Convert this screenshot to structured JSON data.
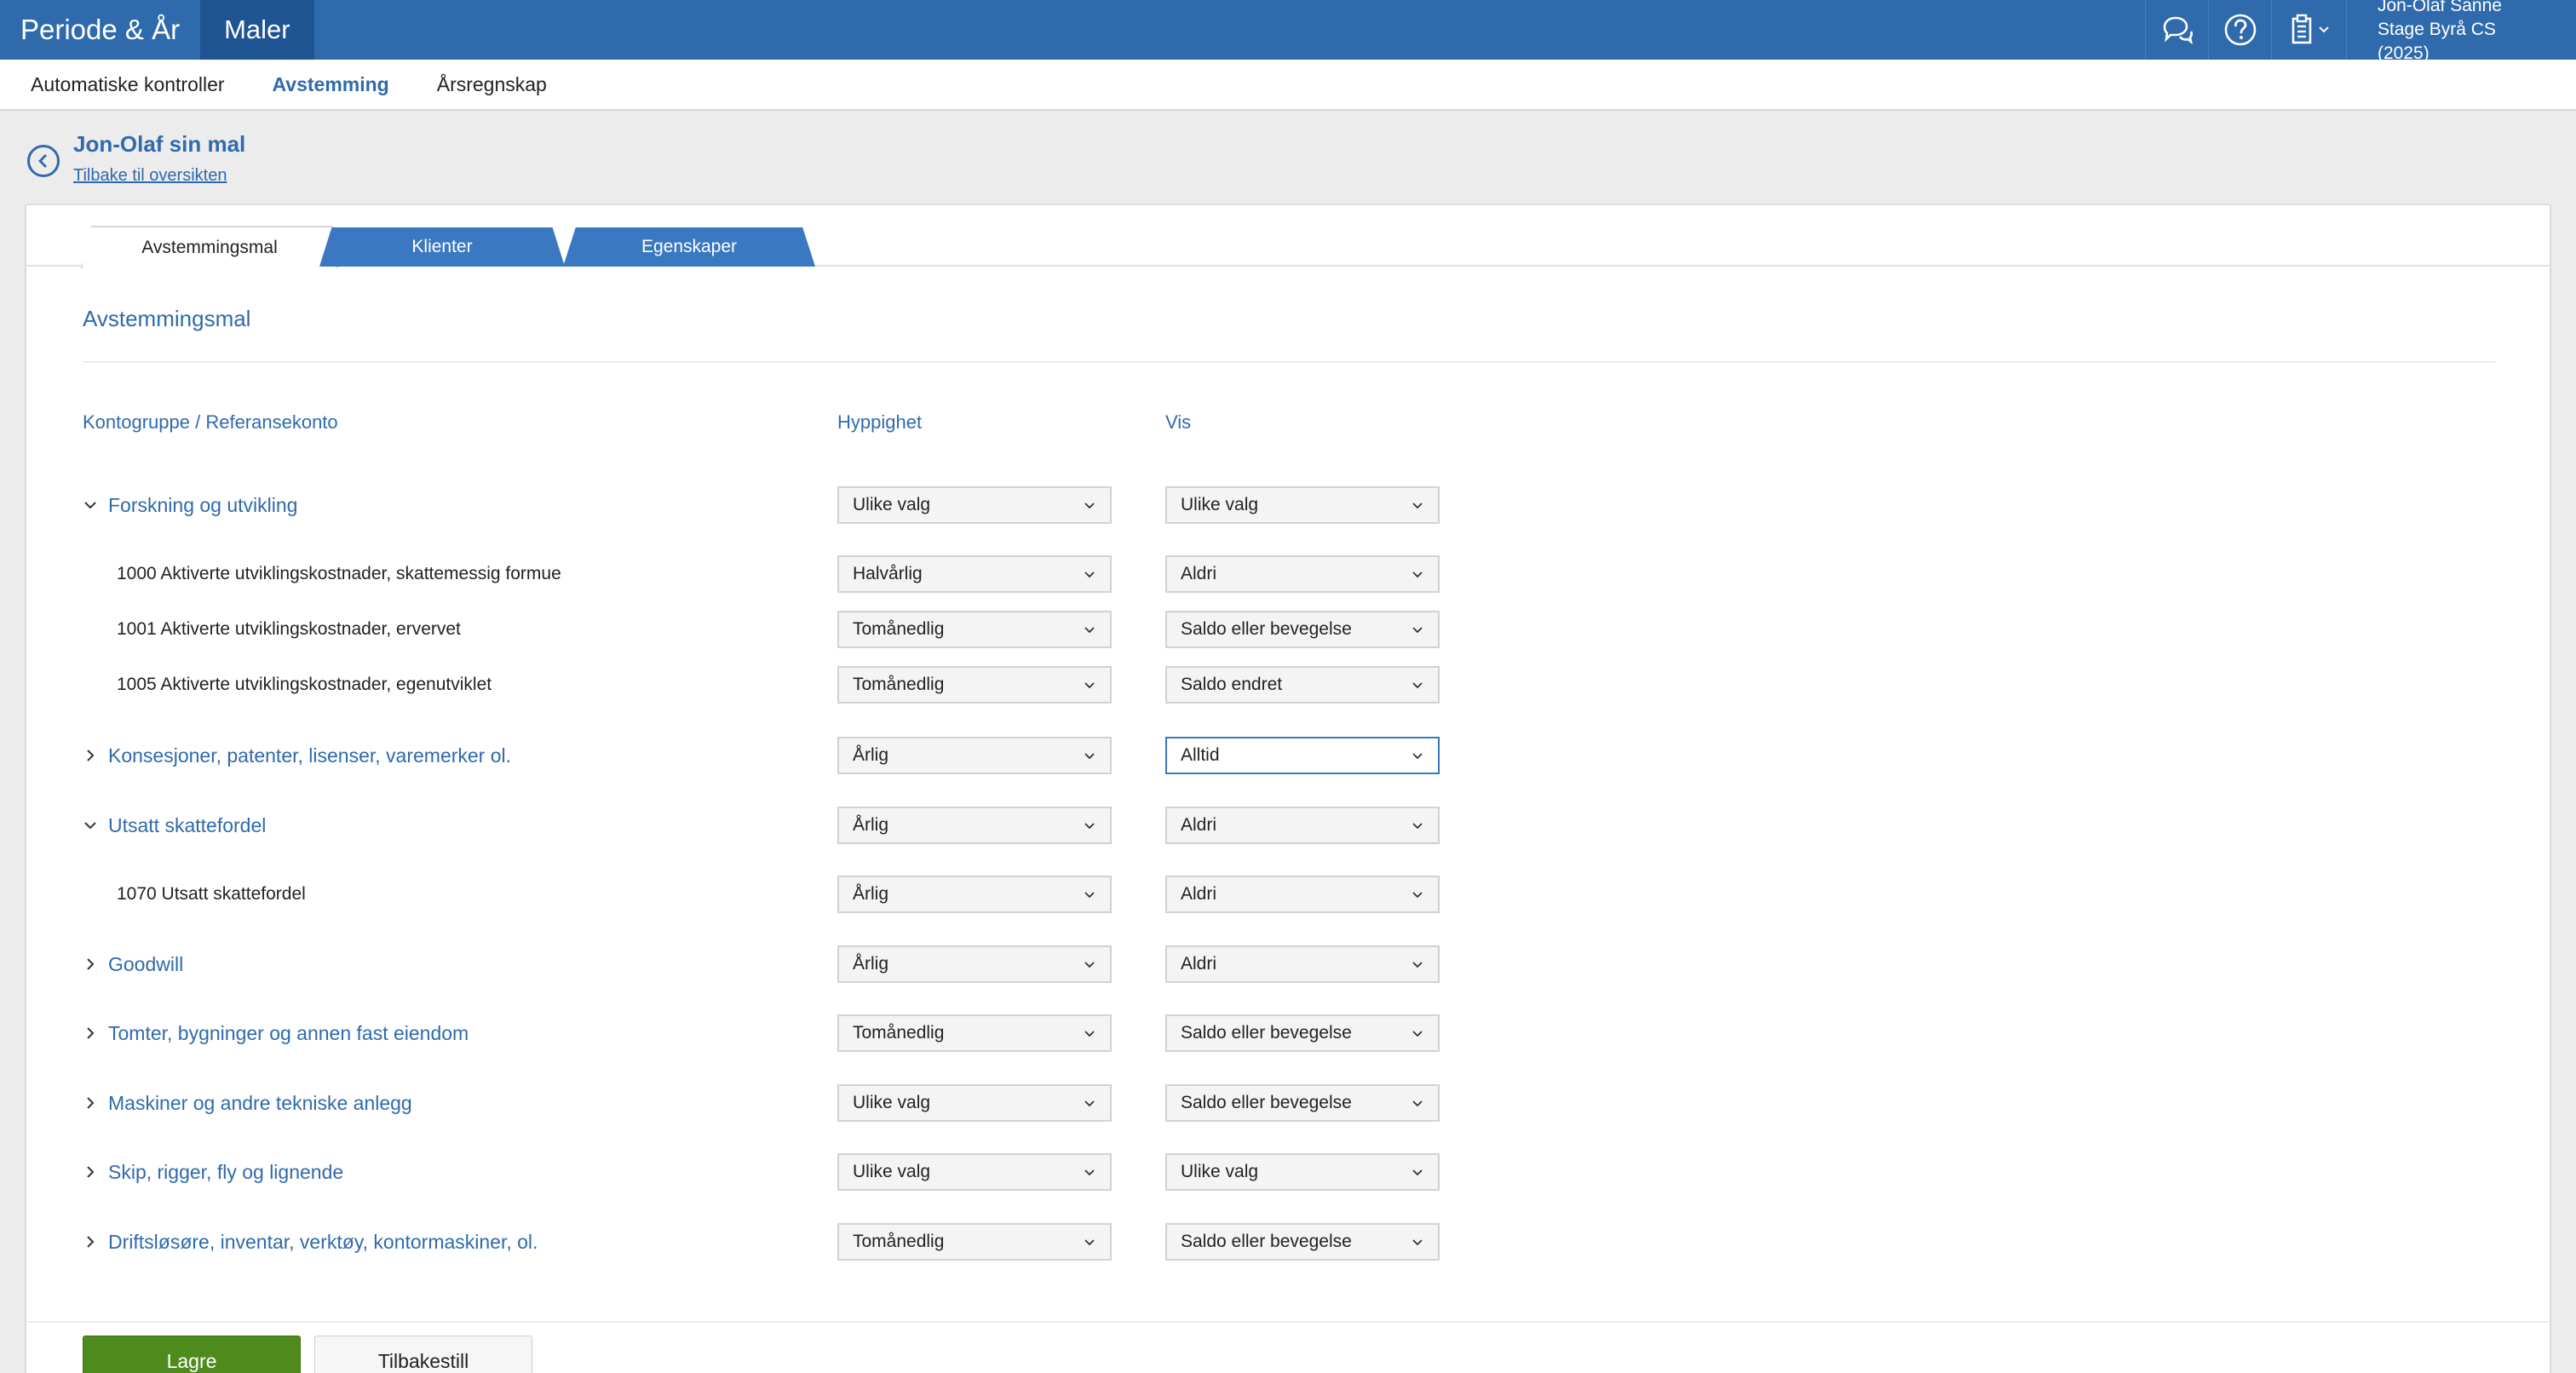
{
  "topbar": {
    "app_title": "Periode & År",
    "active_tab": "Maler",
    "user_name": "Jon-Olaf Sanne",
    "user_org": "Stage Byrå CS (2025)",
    "icons": [
      "chat-icon",
      "help-icon",
      "clipboard-icon"
    ]
  },
  "subnav": {
    "items": [
      {
        "label": "Automatiske kontroller",
        "active": false
      },
      {
        "label": "Avstemming",
        "active": true
      },
      {
        "label": "Årsregnskap",
        "active": false
      }
    ]
  },
  "header": {
    "title": "Jon-Olaf sin mal",
    "back_link": "Tilbake til oversikten"
  },
  "tabs": [
    {
      "label": "Avstemmingsmal",
      "active": true
    },
    {
      "label": "Klienter",
      "active": false
    },
    {
      "label": "Egenskaper",
      "active": false
    }
  ],
  "section": {
    "title": "Avstemmingsmal",
    "columns": {
      "account": "Kontogruppe / Referansekonto",
      "frequency": "Hyppighet",
      "show": "Vis"
    }
  },
  "rows": [
    {
      "type": "group",
      "expanded": true,
      "label": "Forskning og utvikling",
      "frequency": "Ulike valg",
      "show": "Ulike valg"
    },
    {
      "type": "child",
      "label": "1000 Aktiverte utviklingskostnader, skattemessig formue",
      "frequency": "Halvårlig",
      "show": "Aldri"
    },
    {
      "type": "child",
      "label": "1001 Aktiverte utviklingskostnader, ervervet",
      "frequency": "Tomånedlig",
      "show": "Saldo eller bevegelse"
    },
    {
      "type": "child",
      "label": "1005 Aktiverte utviklingskostnader, egenutviklet",
      "frequency": "Tomånedlig",
      "show": "Saldo endret"
    },
    {
      "type": "group",
      "expanded": false,
      "label": "Konsesjoner, patenter, lisenser, varemerker ol.",
      "frequency": "Årlig",
      "show": "Alltid",
      "show_focused": true
    },
    {
      "type": "group",
      "expanded": true,
      "label": "Utsatt skattefordel",
      "frequency": "Årlig",
      "show": "Aldri"
    },
    {
      "type": "child",
      "label": "1070 Utsatt skattefordel",
      "frequency": "Årlig",
      "show": "Aldri"
    },
    {
      "type": "group",
      "expanded": false,
      "label": "Goodwill",
      "frequency": "Årlig",
      "show": "Aldri"
    },
    {
      "type": "group",
      "expanded": false,
      "label": "Tomter, bygninger og annen fast eiendom",
      "frequency": "Tomånedlig",
      "show": "Saldo eller bevegelse"
    },
    {
      "type": "group",
      "expanded": false,
      "label": "Maskiner og andre tekniske anlegg",
      "frequency": "Ulike valg",
      "show": "Saldo eller bevegelse"
    },
    {
      "type": "group",
      "expanded": false,
      "label": "Skip, rigger, fly og lignende",
      "frequency": "Ulike valg",
      "show": "Ulike valg"
    },
    {
      "type": "group",
      "expanded": false,
      "label": "Driftsløsøre, inventar, verktøy, kontormaskiner, ol.",
      "frequency": "Tomånedlig",
      "show": "Saldo eller bevegelse"
    }
  ],
  "buttons": {
    "save": "Lagre",
    "reset": "Tilbakestill"
  },
  "colors": {
    "brand_blue": "#2f6aad",
    "save_green": "#4f8b1c"
  }
}
